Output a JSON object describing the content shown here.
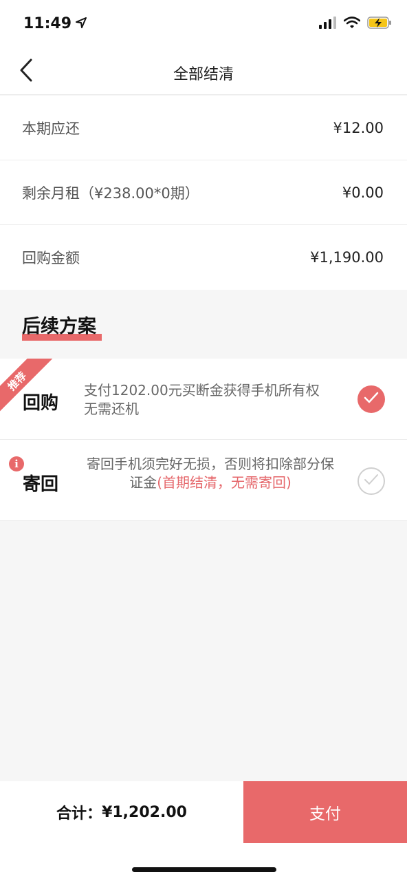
{
  "status_bar": {
    "time": "11:49",
    "icons": [
      "location-arrow-icon",
      "signal-icon",
      "wifi-icon",
      "battery-charging-icon"
    ]
  },
  "nav": {
    "title": "全部结清",
    "back_icon": "chevron-left-icon"
  },
  "rows": [
    {
      "label": "本期应还",
      "value": "¥12.00"
    },
    {
      "label": "剩余月租（¥238.00*0期）",
      "value": "¥0.00"
    },
    {
      "label": "回购金额",
      "value": "¥1,190.00"
    }
  ],
  "section": {
    "title": "后续方案"
  },
  "plans": [
    {
      "badge": "推荐",
      "name": "回购",
      "description": "支付1202.00元买断金获得手机所有权无需还机",
      "selected": true
    },
    {
      "name": "寄回",
      "description": "寄回手机须完好无损，否则将扣除部分保证金",
      "note": "(首期结清，无需寄回)",
      "info_icon": "info-icon",
      "selected": false
    }
  ],
  "footer": {
    "total_label": "合计：",
    "total_value": "¥1,202.00",
    "pay_label": "支付"
  },
  "colors": {
    "accent": "#e8696a",
    "background": "#f6f6f6",
    "battery": "#f5c518"
  }
}
